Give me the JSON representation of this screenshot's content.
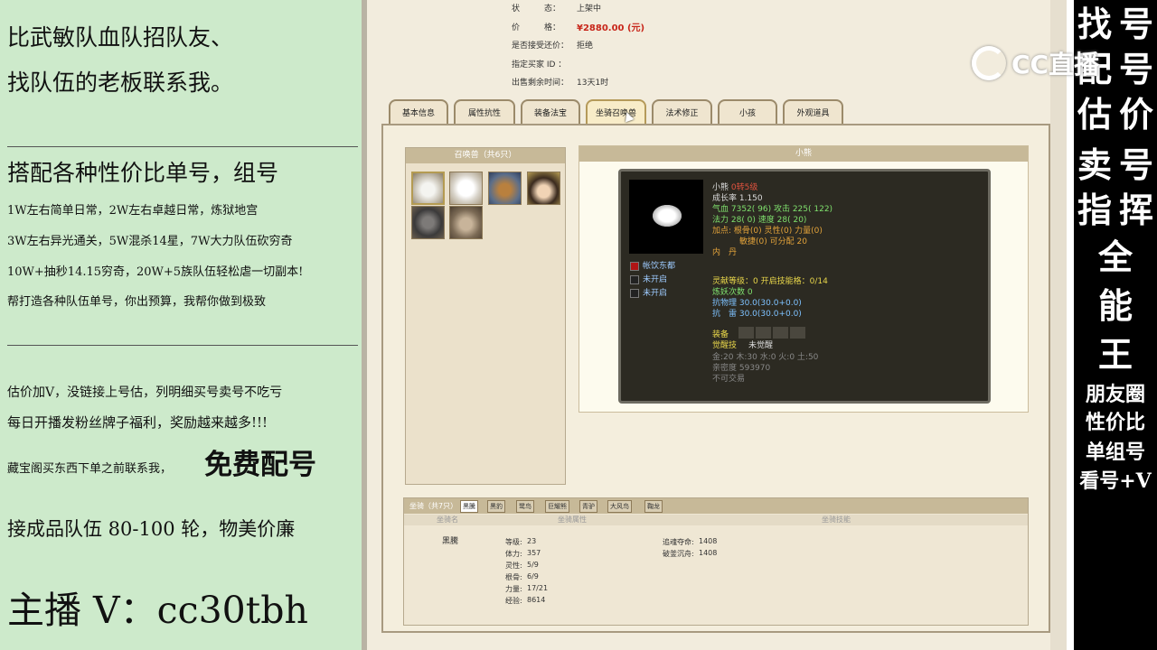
{
  "left_panel": {
    "line1": "比武敏队血队招队友、",
    "line2": "找队伍的老板联系我。",
    "heading": "搭配各种性价比单号，组号",
    "daily": [
      "1W左右简单日常，2W左右卓越日常，炼狱地宫",
      "3W左右异光通关，5W混杀14星，7W大力队伍砍穷奇",
      "10W+抽秒14.15穷奇，20W+5族队伍轻松虐一切副本!",
      "帮打造各种队伍单号，你出预算，我帮你做到极致"
    ],
    "promo1": "估价加V，没链接上号估，列明细买号卖号不吃亏",
    "promo2": "每日开播发粉丝牌子福利，奖励越来越多!!!",
    "promo3a": "藏宝阁买东西下单之前联系我，",
    "promo3b": "免费配号",
    "promo4": "接成品队伍 80-100 轮，物美价廉",
    "anchor": "主播 V：cc30tbh"
  },
  "right_panel": {
    "big_chars": [
      "找",
      "号",
      "配",
      "号",
      "估",
      "价",
      "卖",
      "号",
      "指",
      "挥",
      "全",
      "能",
      "王"
    ],
    "small_lines": [
      "朋友圈",
      "性价比",
      "单组号",
      "看号+V"
    ],
    "logo": "CC直播",
    "logo_icon": "cc-logo-icon"
  },
  "info": [
    {
      "label": "状　　　态：",
      "value": "上架中"
    },
    {
      "label": "价　　　格：",
      "value": "¥2880.00 (元)"
    },
    {
      "label": "是否接受还价：",
      "value": "拒绝"
    },
    {
      "label": "指定买家 ID ：",
      "value": ""
    },
    {
      "label": "出售剩余时间：",
      "value": "13天1时"
    }
  ],
  "tabs": [
    "基本信息",
    "属性抗性",
    "装备法宝",
    "坐骑召唤兽",
    "法术修正",
    "小孩",
    "外观道具"
  ],
  "pets_panel": {
    "header": "召唤兽（共6只）",
    "pets": [
      "pet-polar-bear",
      "pet-white-creature",
      "pet-monkey",
      "pet-girl",
      "pet-wolf",
      "pet-squirrel"
    ]
  },
  "detail": {
    "header": "小熊",
    "name": "小熊",
    "rebirth": "0转5级",
    "growth": "成长率 1.150",
    "hp": "气血 7352( 96) 攻击 225( 122)",
    "mp": "法力 28( 0) 速度 28( 20)",
    "add1": "加点:   根骨(0) 灵性(0) 力量(0)",
    "add2": "敏捷(0) 可分配   20",
    "neidan": "内　丹",
    "skills": [
      "帐饮东都",
      "未开启",
      "未开启"
    ],
    "spirit": "灵献等级：0 开启技能格：0/14",
    "demon": "炼妖次数 0",
    "res1": "抗物理 30.0(30.0+0.0)",
    "res2": "抗　雷 30.0(30.0+0.0)",
    "equip_label": "装备",
    "awake_label": "觉醒技",
    "awake_value": "未觉醒",
    "elements": "金:20 木:30 水:0 火:0 土:50",
    "intimacy": "亲密度 593970",
    "trade": "不可交易"
  },
  "mounts": {
    "header": "坐骑（共7只）",
    "tabs": [
      "黑騰",
      "黑豹",
      "鹭鸟",
      "巨耀熊",
      "青驴",
      "大风鸟",
      "鞠龙"
    ],
    "col_name": "坐骑名",
    "col_attr": "坐骑属性",
    "col_skill": "坐骑技能",
    "name": "黑騰",
    "stats": [
      [
        "等级:",
        "23"
      ],
      [
        "体力:",
        "357"
      ],
      [
        "灵性:",
        "5/9"
      ],
      [
        "根骨:",
        "6/9"
      ],
      [
        "力量:",
        "17/21"
      ],
      [
        "经验:",
        "8614"
      ]
    ],
    "skills": [
      [
        "追魂夺命:",
        "1408"
      ],
      [
        "破釜沉舟:",
        "1408"
      ]
    ]
  }
}
